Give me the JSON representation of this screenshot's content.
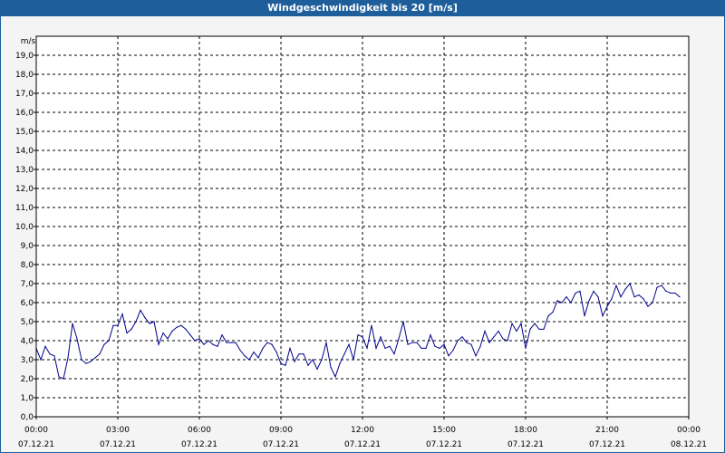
{
  "window": {
    "title": "Windgeschwindigkeit bis 20 [m/s]"
  },
  "colors": {
    "titlebar": "#1e5f9b",
    "series": "#00008b",
    "grid": "#000000",
    "background": "#f4f4f4",
    "plot": "#ffffff"
  },
  "chart_data": {
    "type": "line",
    "title": "Windgeschwindigkeit bis 20 [m/s]",
    "ylabel": "m/s",
    "xlabel": "",
    "ylim": [
      0,
      20
    ],
    "xlim": [
      "07.12.21 00:00",
      "08.12.21 00:00"
    ],
    "grid": true,
    "y_ticks": [
      "0,0",
      "1,0",
      "2,0",
      "3,0",
      "4,0",
      "5,0",
      "6,0",
      "7,0",
      "8,0",
      "9,0",
      "10,0",
      "11,0",
      "12,0",
      "13,0",
      "14,0",
      "15,0",
      "16,0",
      "17,0",
      "18,0",
      "19,0"
    ],
    "x_ticks": [
      {
        "time": "00:00",
        "date": "07.12.21"
      },
      {
        "time": "03:00",
        "date": "07.12.21"
      },
      {
        "time": "06:00",
        "date": "07.12.21"
      },
      {
        "time": "09:00",
        "date": "07.12.21"
      },
      {
        "time": "12:00",
        "date": "07.12.21"
      },
      {
        "time": "15:00",
        "date": "07.12.21"
      },
      {
        "time": "18:00",
        "date": "07.12.21"
      },
      {
        "time": "21:00",
        "date": "07.12.21"
      },
      {
        "time": "00:00",
        "date": "08.12.21"
      }
    ],
    "series": [
      {
        "values": [
          [
            "07.12.21 00:00",
            3.6
          ],
          [
            "07.12.21 00:10",
            3.0
          ],
          [
            "07.12.21 00:20",
            3.7
          ],
          [
            "07.12.21 00:30",
            3.3
          ],
          [
            "07.12.21 00:40",
            3.2
          ],
          [
            "07.12.21 00:50",
            2.1
          ],
          [
            "07.12.21 01:00",
            2.0
          ],
          [
            "07.12.21 01:10",
            3.1
          ],
          [
            "07.12.21 01:20",
            4.9
          ],
          [
            "07.12.21 01:30",
            4.1
          ],
          [
            "07.12.21 01:40",
            3.0
          ],
          [
            "07.12.21 01:50",
            2.8
          ],
          [
            "07.12.21 02:00",
            2.9
          ],
          [
            "07.12.21 02:10",
            3.1
          ],
          [
            "07.12.21 02:20",
            3.3
          ],
          [
            "07.12.21 02:30",
            3.8
          ],
          [
            "07.12.21 02:40",
            4.0
          ],
          [
            "07.12.21 02:50",
            4.8
          ],
          [
            "07.12.21 03:00",
            4.8
          ],
          [
            "07.12.21 03:10",
            5.4
          ],
          [
            "07.12.21 03:20",
            4.4
          ],
          [
            "07.12.21 03:30",
            4.6
          ],
          [
            "07.12.21 03:40",
            5.0
          ],
          [
            "07.12.21 03:50",
            5.6
          ],
          [
            "07.12.21 04:00",
            5.2
          ],
          [
            "07.12.21 04:10",
            4.9
          ],
          [
            "07.12.21 04:20",
            5.0
          ],
          [
            "07.12.21 04:30",
            3.8
          ],
          [
            "07.12.21 04:40",
            4.4
          ],
          [
            "07.12.21 04:50",
            4.1
          ],
          [
            "07.12.21 05:00",
            4.5
          ],
          [
            "07.12.21 05:10",
            4.7
          ],
          [
            "07.12.21 05:20",
            4.8
          ],
          [
            "07.12.21 05:30",
            4.6
          ],
          [
            "07.12.21 05:40",
            4.3
          ],
          [
            "07.12.21 05:50",
            4.0
          ],
          [
            "07.12.21 06:00",
            4.1
          ],
          [
            "07.12.21 06:10",
            3.8
          ],
          [
            "07.12.21 06:20",
            4.0
          ],
          [
            "07.12.21 06:30",
            3.8
          ],
          [
            "07.12.21 06:40",
            3.7
          ],
          [
            "07.12.21 06:50",
            4.3
          ],
          [
            "07.12.21 07:00",
            3.9
          ],
          [
            "07.12.21 07:10",
            3.9
          ],
          [
            "07.12.21 07:20",
            3.9
          ],
          [
            "07.12.21 07:30",
            3.5
          ],
          [
            "07.12.21 07:40",
            3.2
          ],
          [
            "07.12.21 07:50",
            3.0
          ],
          [
            "07.12.21 08:00",
            3.4
          ],
          [
            "07.12.21 08:10",
            3.1
          ],
          [
            "07.12.21 08:20",
            3.6
          ],
          [
            "07.12.21 08:30",
            3.9
          ],
          [
            "07.12.21 08:40",
            3.8
          ],
          [
            "07.12.21 08:50",
            3.4
          ],
          [
            "07.12.21 09:00",
            2.8
          ],
          [
            "07.12.21 09:10",
            2.7
          ],
          [
            "07.12.21 09:20",
            3.6
          ],
          [
            "07.12.21 09:30",
            2.9
          ],
          [
            "07.12.21 09:40",
            3.3
          ],
          [
            "07.12.21 09:50",
            3.3
          ],
          [
            "07.12.21 10:00",
            2.7
          ],
          [
            "07.12.21 10:10",
            3.0
          ],
          [
            "07.12.21 10:20",
            2.5
          ],
          [
            "07.12.21 10:30",
            3.0
          ],
          [
            "07.12.21 10:40",
            3.9
          ],
          [
            "07.12.21 10:50",
            2.6
          ],
          [
            "07.12.21 11:00",
            2.1
          ],
          [
            "07.12.21 11:10",
            2.8
          ],
          [
            "07.12.21 11:20",
            3.3
          ],
          [
            "07.12.21 11:30",
            3.8
          ],
          [
            "07.12.21 11:40",
            3.0
          ],
          [
            "07.12.21 11:50",
            4.3
          ],
          [
            "07.12.21 12:00",
            4.2
          ],
          [
            "07.12.21 12:10",
            3.6
          ],
          [
            "07.12.21 12:20",
            4.8
          ],
          [
            "07.12.21 12:30",
            3.6
          ],
          [
            "07.12.21 12:40",
            4.2
          ],
          [
            "07.12.21 12:50",
            3.6
          ],
          [
            "07.12.21 13:00",
            3.7
          ],
          [
            "07.12.21 13:10",
            3.3
          ],
          [
            "07.12.21 13:20",
            4.1
          ],
          [
            "07.12.21 13:30",
            5.0
          ],
          [
            "07.12.21 13:40",
            3.8
          ],
          [
            "07.12.21 13:50",
            3.9
          ],
          [
            "07.12.21 14:00",
            3.9
          ],
          [
            "07.12.21 14:10",
            3.6
          ],
          [
            "07.12.21 14:20",
            3.6
          ],
          [
            "07.12.21 14:30",
            4.3
          ],
          [
            "07.12.21 14:40",
            3.7
          ],
          [
            "07.12.21 14:50",
            3.6
          ],
          [
            "07.12.21 15:00",
            3.8
          ],
          [
            "07.12.21 15:10",
            3.2
          ],
          [
            "07.12.21 15:20",
            3.5
          ],
          [
            "07.12.21 15:30",
            4.0
          ],
          [
            "07.12.21 15:40",
            4.2
          ],
          [
            "07.12.21 15:50",
            3.9
          ],
          [
            "07.12.21 16:00",
            3.8
          ],
          [
            "07.12.21 16:10",
            3.2
          ],
          [
            "07.12.21 16:20",
            3.7
          ],
          [
            "07.12.21 16:30",
            4.5
          ],
          [
            "07.12.21 16:40",
            3.9
          ],
          [
            "07.12.21 16:50",
            4.2
          ],
          [
            "07.12.21 17:00",
            4.5
          ],
          [
            "07.12.21 17:10",
            4.1
          ],
          [
            "07.12.21 17:20",
            4.0
          ],
          [
            "07.12.21 17:30",
            4.9
          ],
          [
            "07.12.21 17:40",
            4.5
          ],
          [
            "07.12.21 17:50",
            4.9
          ],
          [
            "07.12.21 18:00",
            3.6
          ],
          [
            "07.12.21 18:10",
            4.6
          ],
          [
            "07.12.21 18:20",
            4.9
          ],
          [
            "07.12.21 18:30",
            4.6
          ],
          [
            "07.12.21 18:40",
            4.6
          ],
          [
            "07.12.21 18:50",
            5.3
          ],
          [
            "07.12.21 19:00",
            5.5
          ],
          [
            "07.12.21 19:10",
            6.1
          ],
          [
            "07.12.21 19:20",
            6.0
          ],
          [
            "07.12.21 19:30",
            6.3
          ],
          [
            "07.12.21 19:40",
            6.0
          ],
          [
            "07.12.21 19:50",
            6.5
          ],
          [
            "07.12.21 20:00",
            6.6
          ],
          [
            "07.12.21 20:10",
            5.3
          ],
          [
            "07.12.21 20:20",
            6.1
          ],
          [
            "07.12.21 20:30",
            6.6
          ],
          [
            "07.12.21 20:40",
            6.3
          ],
          [
            "07.12.21 20:50",
            5.3
          ],
          [
            "07.12.21 21:00",
            5.8
          ],
          [
            "07.12.21 21:10",
            6.2
          ],
          [
            "07.12.21 21:20",
            6.9
          ],
          [
            "07.12.21 21:30",
            6.3
          ],
          [
            "07.12.21 21:40",
            6.7
          ],
          [
            "07.12.21 21:50",
            7.0
          ],
          [
            "07.12.21 22:00",
            6.3
          ],
          [
            "07.12.21 22:10",
            6.4
          ],
          [
            "07.12.21 22:20",
            6.2
          ],
          [
            "07.12.21 22:30",
            5.8
          ],
          [
            "07.12.21 22:40",
            6.0
          ],
          [
            "07.12.21 22:50",
            6.8
          ],
          [
            "07.12.21 23:00",
            6.9
          ],
          [
            "07.12.21 23:10",
            6.6
          ],
          [
            "07.12.21 23:20",
            6.5
          ],
          [
            "07.12.21 23:30",
            6.5
          ],
          [
            "07.12.21 23:40",
            6.3
          ]
        ]
      }
    ]
  }
}
